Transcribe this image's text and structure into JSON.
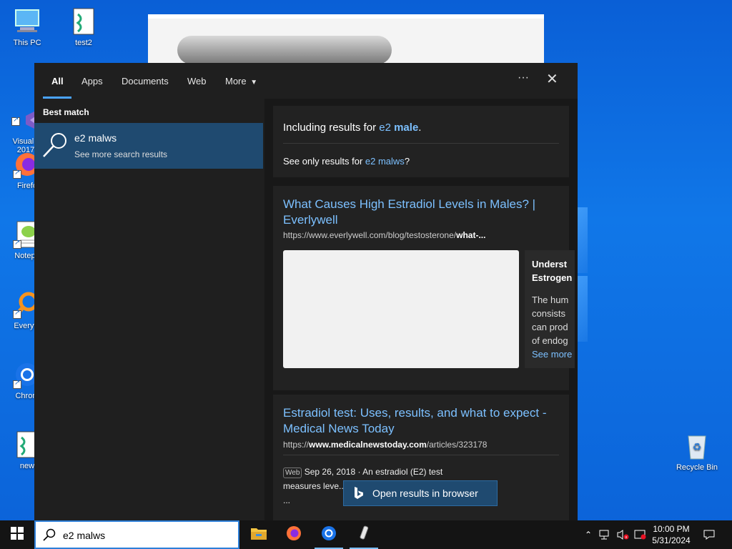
{
  "desktop": {
    "icons": [
      {
        "label": "This PC"
      },
      {
        "label": "test2"
      },
      {
        "label": "Visual St\n2017"
      },
      {
        "label": "Firefo"
      },
      {
        "label": "Notepa"
      },
      {
        "label": "Everyth"
      },
      {
        "label": "Chrom"
      },
      {
        "label": "new"
      },
      {
        "label": "Recycle Bin"
      }
    ]
  },
  "search_panel": {
    "tabs": [
      "All",
      "Apps",
      "Documents",
      "Web",
      "More"
    ],
    "more_icon": "ellipsis-icon",
    "close_icon": "close-icon",
    "best_match_label": "Best match",
    "best_match": {
      "title": "e2 malws",
      "subtitle": "See more search results"
    },
    "spell": {
      "prefix": "Including results for ",
      "q1": "e2",
      "q2": "male",
      "suffix": ".",
      "seeonly_prefix": "See only results for ",
      "seeonly_link": "e2 malws",
      "seeonly_suffix": "?"
    },
    "result1": {
      "title": "What Causes High Estradiol Levels in Males? | Everlywell",
      "url_plain": "https://www.everlywell.com/blog/testosterone/",
      "url_bold": "what-...",
      "side_heading": "Underst Estrogen",
      "side_text": "The hum consists can prod of endog",
      "side_link": "See more"
    },
    "result2": {
      "title": "Estradiol test: Uses, results, and what to expect - Medical News Today",
      "url_prefix": "https://",
      "url_bold": "www.medicalnewstoday.com",
      "url_suffix": "/articles/323178",
      "tag": "Web",
      "date": "Sep 26, 2018",
      "snippet": " · An estradiol (E2) test measures leve... blood. The res... from fertility ..."
    },
    "open_browser": "Open results in browser"
  },
  "taskbar": {
    "search_value": "e2 malws",
    "apps": [
      "file-explorer-icon",
      "firefox-icon",
      "chrome-icon",
      "notepad-icon"
    ],
    "time": "10:00 PM",
    "date": "5/31/2024"
  },
  "colors": {
    "accent": "#4aa3ff",
    "link": "#7cc0ff",
    "selection": "#1f4a70"
  }
}
